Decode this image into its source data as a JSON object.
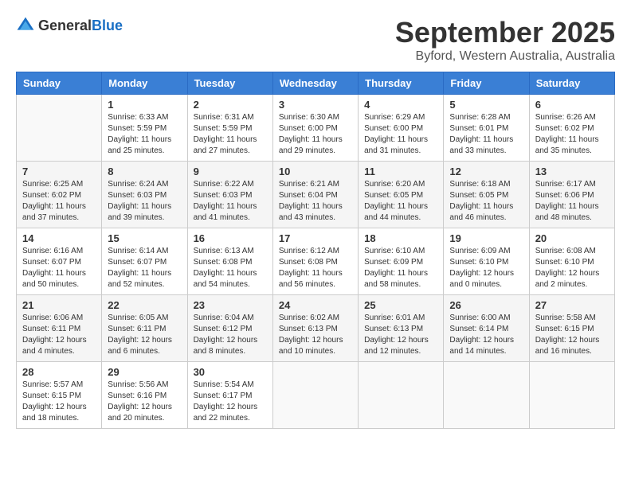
{
  "header": {
    "logo_general": "General",
    "logo_blue": "Blue",
    "month": "September 2025",
    "location": "Byford, Western Australia, Australia"
  },
  "days_of_week": [
    "Sunday",
    "Monday",
    "Tuesday",
    "Wednesday",
    "Thursday",
    "Friday",
    "Saturday"
  ],
  "weeks": [
    [
      {
        "day": "",
        "info": ""
      },
      {
        "day": "1",
        "info": "Sunrise: 6:33 AM\nSunset: 5:59 PM\nDaylight: 11 hours\nand 25 minutes."
      },
      {
        "day": "2",
        "info": "Sunrise: 6:31 AM\nSunset: 5:59 PM\nDaylight: 11 hours\nand 27 minutes."
      },
      {
        "day": "3",
        "info": "Sunrise: 6:30 AM\nSunset: 6:00 PM\nDaylight: 11 hours\nand 29 minutes."
      },
      {
        "day": "4",
        "info": "Sunrise: 6:29 AM\nSunset: 6:00 PM\nDaylight: 11 hours\nand 31 minutes."
      },
      {
        "day": "5",
        "info": "Sunrise: 6:28 AM\nSunset: 6:01 PM\nDaylight: 11 hours\nand 33 minutes."
      },
      {
        "day": "6",
        "info": "Sunrise: 6:26 AM\nSunset: 6:02 PM\nDaylight: 11 hours\nand 35 minutes."
      }
    ],
    [
      {
        "day": "7",
        "info": "Sunrise: 6:25 AM\nSunset: 6:02 PM\nDaylight: 11 hours\nand 37 minutes."
      },
      {
        "day": "8",
        "info": "Sunrise: 6:24 AM\nSunset: 6:03 PM\nDaylight: 11 hours\nand 39 minutes."
      },
      {
        "day": "9",
        "info": "Sunrise: 6:22 AM\nSunset: 6:03 PM\nDaylight: 11 hours\nand 41 minutes."
      },
      {
        "day": "10",
        "info": "Sunrise: 6:21 AM\nSunset: 6:04 PM\nDaylight: 11 hours\nand 43 minutes."
      },
      {
        "day": "11",
        "info": "Sunrise: 6:20 AM\nSunset: 6:05 PM\nDaylight: 11 hours\nand 44 minutes."
      },
      {
        "day": "12",
        "info": "Sunrise: 6:18 AM\nSunset: 6:05 PM\nDaylight: 11 hours\nand 46 minutes."
      },
      {
        "day": "13",
        "info": "Sunrise: 6:17 AM\nSunset: 6:06 PM\nDaylight: 11 hours\nand 48 minutes."
      }
    ],
    [
      {
        "day": "14",
        "info": "Sunrise: 6:16 AM\nSunset: 6:07 PM\nDaylight: 11 hours\nand 50 minutes."
      },
      {
        "day": "15",
        "info": "Sunrise: 6:14 AM\nSunset: 6:07 PM\nDaylight: 11 hours\nand 52 minutes."
      },
      {
        "day": "16",
        "info": "Sunrise: 6:13 AM\nSunset: 6:08 PM\nDaylight: 11 hours\nand 54 minutes."
      },
      {
        "day": "17",
        "info": "Sunrise: 6:12 AM\nSunset: 6:08 PM\nDaylight: 11 hours\nand 56 minutes."
      },
      {
        "day": "18",
        "info": "Sunrise: 6:10 AM\nSunset: 6:09 PM\nDaylight: 11 hours\nand 58 minutes."
      },
      {
        "day": "19",
        "info": "Sunrise: 6:09 AM\nSunset: 6:10 PM\nDaylight: 12 hours\nand 0 minutes."
      },
      {
        "day": "20",
        "info": "Sunrise: 6:08 AM\nSunset: 6:10 PM\nDaylight: 12 hours\nand 2 minutes."
      }
    ],
    [
      {
        "day": "21",
        "info": "Sunrise: 6:06 AM\nSunset: 6:11 PM\nDaylight: 12 hours\nand 4 minutes."
      },
      {
        "day": "22",
        "info": "Sunrise: 6:05 AM\nSunset: 6:11 PM\nDaylight: 12 hours\nand 6 minutes."
      },
      {
        "day": "23",
        "info": "Sunrise: 6:04 AM\nSunset: 6:12 PM\nDaylight: 12 hours\nand 8 minutes."
      },
      {
        "day": "24",
        "info": "Sunrise: 6:02 AM\nSunset: 6:13 PM\nDaylight: 12 hours\nand 10 minutes."
      },
      {
        "day": "25",
        "info": "Sunrise: 6:01 AM\nSunset: 6:13 PM\nDaylight: 12 hours\nand 12 minutes."
      },
      {
        "day": "26",
        "info": "Sunrise: 6:00 AM\nSunset: 6:14 PM\nDaylight: 12 hours\nand 14 minutes."
      },
      {
        "day": "27",
        "info": "Sunrise: 5:58 AM\nSunset: 6:15 PM\nDaylight: 12 hours\nand 16 minutes."
      }
    ],
    [
      {
        "day": "28",
        "info": "Sunrise: 5:57 AM\nSunset: 6:15 PM\nDaylight: 12 hours\nand 18 minutes."
      },
      {
        "day": "29",
        "info": "Sunrise: 5:56 AM\nSunset: 6:16 PM\nDaylight: 12 hours\nand 20 minutes."
      },
      {
        "day": "30",
        "info": "Sunrise: 5:54 AM\nSunset: 6:17 PM\nDaylight: 12 hours\nand 22 minutes."
      },
      {
        "day": "",
        "info": ""
      },
      {
        "day": "",
        "info": ""
      },
      {
        "day": "",
        "info": ""
      },
      {
        "day": "",
        "info": ""
      }
    ]
  ]
}
